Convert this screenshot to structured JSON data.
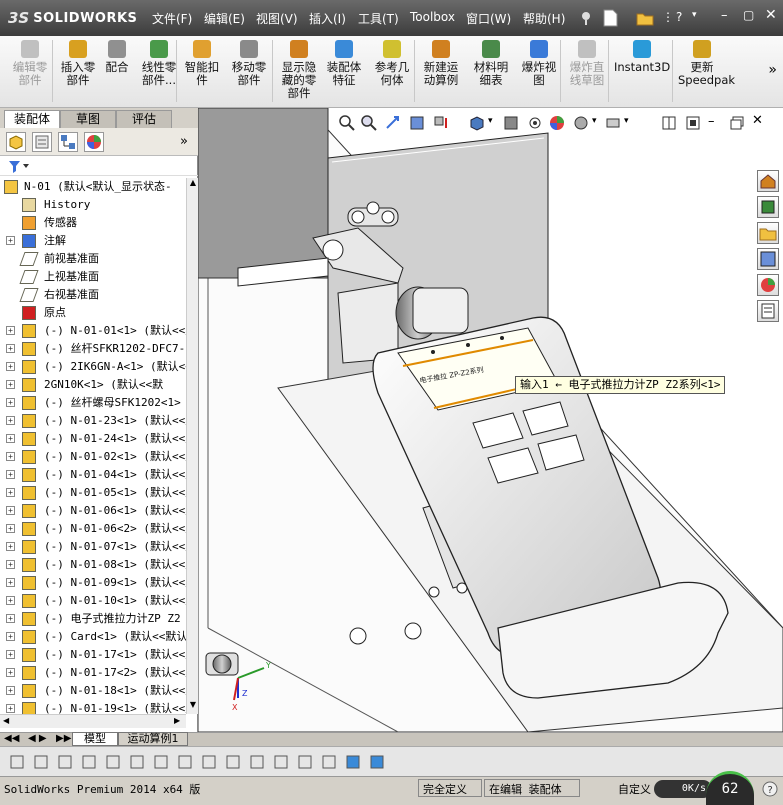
{
  "app": {
    "logo_ds": "3S",
    "logo_name": "SOLIDWORKS"
  },
  "menu": [
    "文件(F)",
    "编辑(E)",
    "视图(V)",
    "插入(I)",
    "工具(T)",
    "Toolbox",
    "窗口(W)",
    "帮助(H)"
  ],
  "ribbon": [
    {
      "label": "编辑零\n部件",
      "disabled": true,
      "icon": "edit-component-icon"
    },
    {
      "label": "插入零\n部件",
      "disabled": false,
      "icon": "insert-component-icon"
    },
    {
      "label": "配合",
      "disabled": false,
      "icon": "mate-icon"
    },
    {
      "label": "线性零\n部件...",
      "disabled": false,
      "icon": "linear-pattern-icon"
    },
    {
      "label": "智能扣\n件",
      "disabled": false,
      "icon": "smart-fasteners-icon"
    },
    {
      "label": "移动零\n部件",
      "disabled": false,
      "icon": "move-component-icon"
    },
    {
      "label": "显示隐\n藏的零\n部件",
      "disabled": false,
      "icon": "show-hidden-icon"
    },
    {
      "label": "装配体\n特征",
      "disabled": false,
      "icon": "assembly-feature-icon"
    },
    {
      "label": "参考几\n何体",
      "disabled": false,
      "icon": "reference-geometry-icon"
    },
    {
      "label": "新建运\n动算例",
      "disabled": false,
      "icon": "new-motion-study-icon"
    },
    {
      "label": "材料明\n细表",
      "disabled": false,
      "icon": "bom-icon"
    },
    {
      "label": "爆炸视\n图",
      "disabled": false,
      "icon": "exploded-view-icon"
    },
    {
      "label": "爆炸直\n线草图",
      "disabled": true,
      "icon": "explode-line-sketch-icon"
    },
    {
      "label": "Instant3D",
      "disabled": false,
      "icon": "instant3d-icon"
    },
    {
      "label": "更新\nSpeedpak",
      "disabled": false,
      "icon": "speedpak-icon"
    }
  ],
  "cm_tabs": [
    "装配体",
    "草图",
    "评估"
  ],
  "tree": [
    {
      "label": "N-01  (默认<默认_显示状态-",
      "exp": "",
      "icon": "assembly-icon",
      "indent": 0
    },
    {
      "label": "History",
      "exp": "",
      "icon": "history-icon",
      "indent": 1
    },
    {
      "label": "传感器",
      "exp": "",
      "icon": "sensor-icon",
      "indent": 1
    },
    {
      "label": "注解",
      "exp": "+",
      "icon": "annotation-icon",
      "indent": 1
    },
    {
      "label": "前视基准面",
      "exp": "",
      "icon": "plane-icon",
      "indent": 1
    },
    {
      "label": "上视基准面",
      "exp": "",
      "icon": "plane-icon",
      "indent": 1
    },
    {
      "label": "右视基准面",
      "exp": "",
      "icon": "plane-icon",
      "indent": 1
    },
    {
      "label": "原点",
      "exp": "",
      "icon": "origin-icon",
      "indent": 1
    },
    {
      "label": "(-) N-01-01<1> (默认<<默",
      "exp": "+",
      "icon": "part-icon",
      "indent": 1
    },
    {
      "label": "(-) 丝杆SFKR1202-DFC7-2",
      "exp": "+",
      "icon": "part-icon",
      "indent": 1
    },
    {
      "label": "(-) 2IK6GN-A<1> (默认<<",
      "exp": "+",
      "icon": "part-icon",
      "indent": 1
    },
    {
      "label": "2GN10K<1> (默认<<默",
      "exp": "+",
      "icon": "part-icon",
      "indent": 1
    },
    {
      "label": "(-) 丝杆螺母SFK1202<1>",
      "exp": "+",
      "icon": "part-icon",
      "indent": 1
    },
    {
      "label": "(-) N-01-23<1> (默认<<默",
      "exp": "+",
      "icon": "part-icon",
      "indent": 1
    },
    {
      "label": "(-) N-01-24<1> (默认<<默",
      "exp": "+",
      "icon": "part-icon",
      "indent": 1
    },
    {
      "label": "(-) N-01-02<1> (默认<<默",
      "exp": "+",
      "icon": "part-icon",
      "indent": 1
    },
    {
      "label": "(-) N-01-04<1> (默认<<默",
      "exp": "+",
      "icon": "part-icon",
      "indent": 1
    },
    {
      "label": "(-) N-01-05<1> (默认<<默",
      "exp": "+",
      "icon": "part-icon",
      "indent": 1
    },
    {
      "label": "(-) N-01-06<1> (默认<<默",
      "exp": "+",
      "icon": "part-icon",
      "indent": 1
    },
    {
      "label": "(-) N-01-06<2> (默认<<默",
      "exp": "+",
      "icon": "part-icon",
      "indent": 1
    },
    {
      "label": "(-) N-01-07<1> (默认<<默",
      "exp": "+",
      "icon": "part-icon",
      "indent": 1
    },
    {
      "label": "(-) N-01-08<1> (默认<<默",
      "exp": "+",
      "icon": "part-icon",
      "indent": 1
    },
    {
      "label": "(-) N-01-09<1> (默认<<默",
      "exp": "+",
      "icon": "part-icon",
      "indent": 1
    },
    {
      "label": "(-) N-01-10<1> (默认<<默",
      "exp": "+",
      "icon": "part-icon",
      "indent": 1
    },
    {
      "label": "(-) 电子式推拉力计ZP Z2",
      "exp": "+",
      "icon": "part-icon",
      "indent": 1
    },
    {
      "label": "(-) Card<1> (默认<<默认",
      "exp": "+",
      "icon": "part-icon",
      "indent": 1
    },
    {
      "label": "(-) N-01-17<1> (默认<<默",
      "exp": "+",
      "icon": "part-icon",
      "indent": 1
    },
    {
      "label": "(-) N-01-17<2> (默认<<默",
      "exp": "+",
      "icon": "part-icon",
      "indent": 1
    },
    {
      "label": "(-) N-01-18<1> (默认<<默",
      "exp": "+",
      "icon": "part-icon",
      "indent": 1
    },
    {
      "label": "(-) N-01-19<1> (默认<<默",
      "exp": "+",
      "icon": "part-icon",
      "indent": 1
    }
  ],
  "bottom_tabs": [
    "模型",
    "运动算例1"
  ],
  "tooltip": "输入1 ← 电子式推拉力计ZP Z2系列<1>",
  "gauge_text": "电子推拉 ZP-Z2系列",
  "status": {
    "app": "SolidWorks Premium 2014 x64 版",
    "defined": "完全定义",
    "editing": "在编辑 装配体",
    "custom": "自定义",
    "speed": "0K/s",
    "gauge": "62"
  },
  "colors": {
    "accent": "#e08a00",
    "titlebar": "#4a4a4a",
    "viewport_bg": "#ffffff"
  }
}
